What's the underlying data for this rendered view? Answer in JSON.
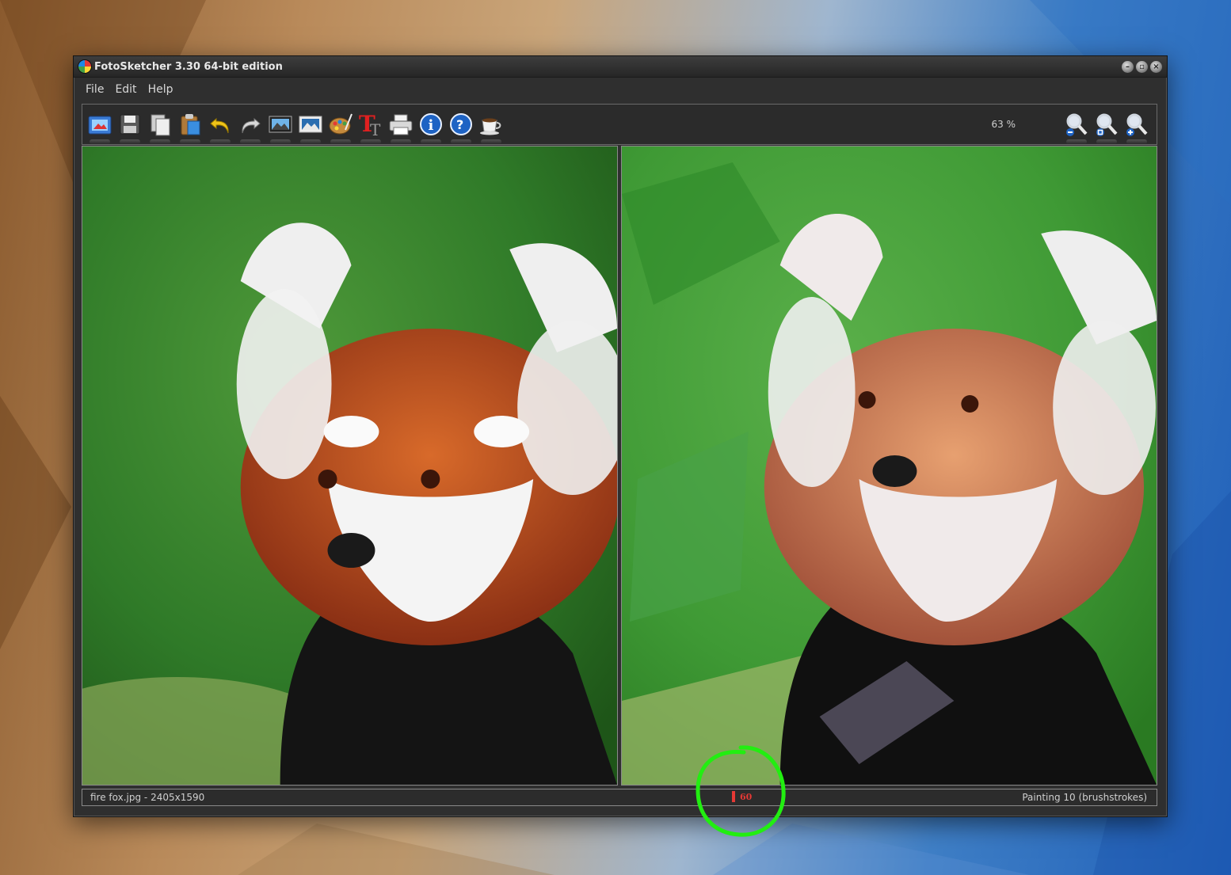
{
  "window": {
    "title": "FotoSketcher 3.30 64-bit edition",
    "controls": [
      "minimize",
      "maximize",
      "close"
    ]
  },
  "menu": [
    "File",
    "Edit",
    "Help"
  ],
  "toolbar": {
    "tools": [
      {
        "name": "open-image-icon"
      },
      {
        "name": "save-icon"
      },
      {
        "name": "copy-icon"
      },
      {
        "name": "paste-icon"
      },
      {
        "name": "undo-icon"
      },
      {
        "name": "redo-icon"
      },
      {
        "name": "source-image-icon"
      },
      {
        "name": "result-image-icon"
      },
      {
        "name": "palette-icon"
      },
      {
        "name": "text-icon"
      },
      {
        "name": "print-icon"
      },
      {
        "name": "info-icon"
      },
      {
        "name": "help-icon"
      },
      {
        "name": "donate-coffee-icon"
      }
    ],
    "zoom_value": "63 %",
    "zoom_tools": [
      {
        "name": "zoom-out-icon"
      },
      {
        "name": "zoom-fit-icon"
      },
      {
        "name": "zoom-in-icon"
      }
    ]
  },
  "status": {
    "file_info": "fire fox.jpg - 2405x1590",
    "progress_value": "60",
    "effect": "Painting 10 (brushstrokes)"
  },
  "colors": {
    "progress": "#e53935",
    "annotation": "#22ee11"
  }
}
